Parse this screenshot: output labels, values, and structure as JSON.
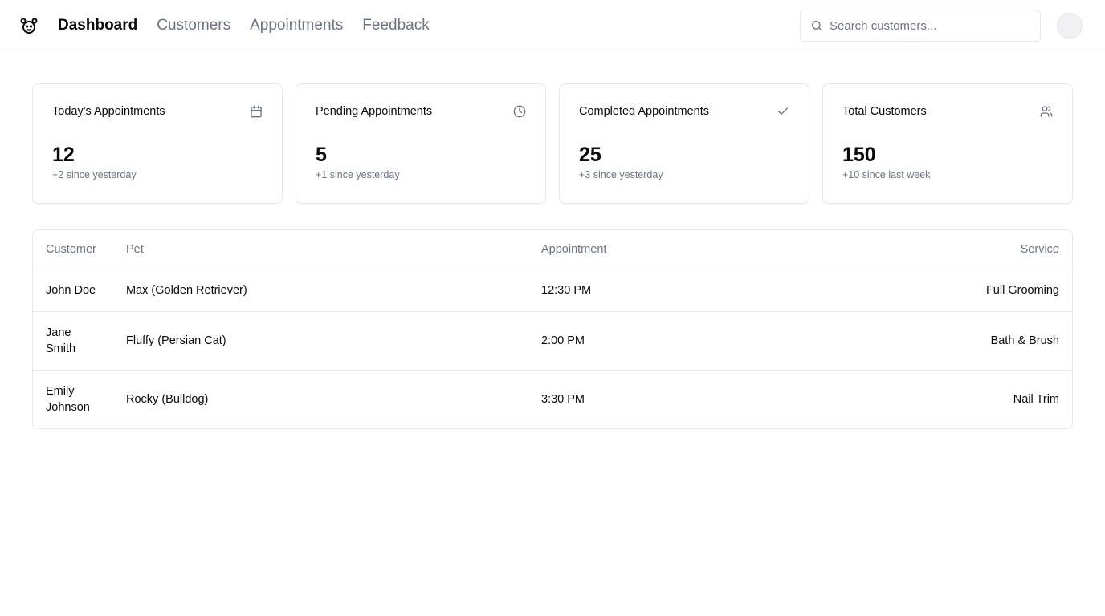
{
  "nav": {
    "items": [
      {
        "label": "Dashboard",
        "active": true
      },
      {
        "label": "Customers",
        "active": false
      },
      {
        "label": "Appointments",
        "active": false
      },
      {
        "label": "Feedback",
        "active": false
      }
    ]
  },
  "search": {
    "placeholder": "Search customers..."
  },
  "stats": [
    {
      "title": "Today's Appointments",
      "value": "12",
      "sub": "+2 since yesterday",
      "icon": "calendar-icon"
    },
    {
      "title": "Pending Appointments",
      "value": "5",
      "sub": "+1 since yesterday",
      "icon": "clock-icon"
    },
    {
      "title": "Completed Appointments",
      "value": "25",
      "sub": "+3 since yesterday",
      "icon": "check-icon"
    },
    {
      "title": "Total Customers",
      "value": "150",
      "sub": "+10 since last week",
      "icon": "users-icon"
    }
  ],
  "table": {
    "headers": [
      "Customer",
      "Pet",
      "Appointment",
      "Service"
    ],
    "rows": [
      {
        "customer": "John Doe",
        "pet": "Max (Golden Retriever)",
        "time": "12:30 PM",
        "service": "Full Grooming"
      },
      {
        "customer": "Jane Smith",
        "pet": "Fluffy (Persian Cat)",
        "time": "2:00 PM",
        "service": "Bath & Brush"
      },
      {
        "customer": "Emily Johnson",
        "pet": "Rocky (Bulldog)",
        "time": "3:30 PM",
        "service": "Nail Trim"
      }
    ]
  },
  "colors": {
    "text": "#0a0a0a",
    "muted": "#6b7280",
    "border": "#e5e7eb"
  }
}
